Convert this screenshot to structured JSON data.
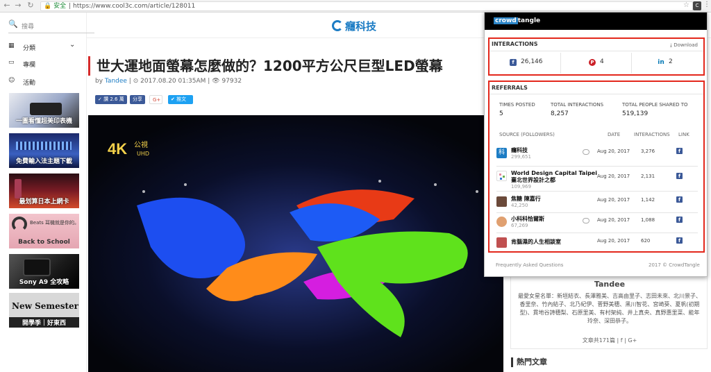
{
  "browser": {
    "secure_label": "安全",
    "url": "https://www.cool3c.com/article/128011"
  },
  "sidebar": {
    "search_placeholder": "搜尋",
    "items": [
      {
        "icon": "grid-icon",
        "label": "分類"
      },
      {
        "icon": "monitor-icon",
        "label": "專欄"
      },
      {
        "icon": "smile-icon",
        "label": "活動"
      }
    ],
    "thumbs": [
      {
        "caption": "一圖看懂超美印表機"
      },
      {
        "caption": "免費輸入法主題下載"
      },
      {
        "caption": "最划算日本上網卡"
      },
      {
        "caption": "Back to School",
        "overlay": "Beats 耳機就是你的。"
      },
      {
        "caption": "Sony A9 全攻略"
      },
      {
        "caption": "開學季｜好東西",
        "overlay": "New Semester"
      }
    ]
  },
  "header": {
    "site_name": "癮科技"
  },
  "article": {
    "title": "世大運地面螢幕怎麼做的？1200平方公尺巨型LED螢幕",
    "meta_by": "by",
    "author": "Tandee",
    "date": "2017.08.20 01:35AM",
    "views": "97932",
    "share_like": "讚 2.6 萬",
    "share_fb": "分享",
    "share_gplus": "G+",
    "share_tweet": "推文",
    "hero_badge_main": "4K",
    "hero_badge_sub": "公視",
    "hero_badge_uhd": "UHD"
  },
  "author_card": {
    "name": "Tandee",
    "bio": "最愛女星名單：新垣結衣、長澤雅美、吉高由里子、志田未來、北川景子、香里奈、竹內結子、北乃紀伊、菅野美穗、黑川智花、宮崎葵、夏帆(初期型)、貫地谷詩穗梨、石原里美、有村架純、井上真央、真野惠里菜、能年玲奈、深田恭子。",
    "stats": "文章共171篇  |  f  |  G+"
  },
  "hot_articles_title": "熱門文章",
  "crowdtangle": {
    "brand_a": "crowd",
    "brand_b": "tangle",
    "interactions_label": "INTERACTIONS",
    "download_label": "Download",
    "interactions": [
      {
        "network": "facebook",
        "icon": "facebook-icon",
        "value": "26,146",
        "color": "#3b5998"
      },
      {
        "network": "pinterest",
        "icon": "pinterest-icon",
        "value": "4",
        "color": "#cb2027"
      },
      {
        "network": "linkedin",
        "icon": "linkedin-icon",
        "value": "2",
        "color": "#0077b5"
      }
    ],
    "referrals_label": "REFERRALS",
    "times_posted_label": "TIMES POSTED",
    "times_posted": "5",
    "total_interactions_label": "TOTAL INTERACTIONS",
    "total_interactions": "8,257",
    "total_people_label": "TOTAL PEOPLE SHARED TO",
    "total_people": "519,139",
    "columns": {
      "source": "SOURCE (FOLLOWERS)",
      "date": "DATE",
      "interactions": "INTERACTIONS",
      "link": "LINK"
    },
    "rows": [
      {
        "name": "癮科技",
        "followers": "299,651",
        "date": "Aug 20, 2017",
        "interactions": "3,276",
        "avatar_color": "#1c7cc4"
      },
      {
        "name": "World Design Capital Taipei 臺北世界設計之都",
        "followers": "109,969",
        "date": "Aug 20, 2017",
        "interactions": "2,131",
        "avatar_color": "#e58aa0"
      },
      {
        "name": "焦糖 陳嘉行",
        "followers": "42,250",
        "date": "Aug 20, 2017",
        "interactions": "1,142",
        "avatar_color": "#6b4a3a"
      },
      {
        "name": "小科科恰爾斯",
        "followers": "67,269",
        "date": "Aug 20, 2017",
        "interactions": "1,088",
        "avatar_color": "#e0a070"
      },
      {
        "name": "肯腦濕的人生相談室",
        "followers": "",
        "date": "Aug 20, 2017",
        "interactions": "620",
        "avatar_color": "#c05050"
      }
    ],
    "faq_label": "Frequently Asked Questions",
    "copyright": "2017 © CrowdTangle"
  }
}
